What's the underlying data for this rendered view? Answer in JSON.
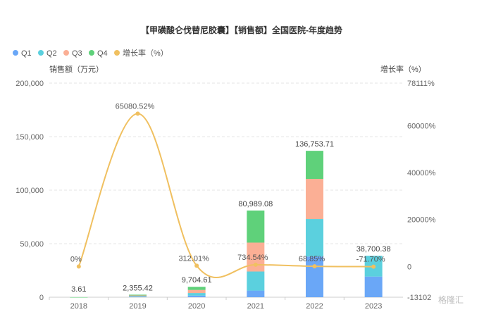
{
  "chart_data": {
    "type": "bar",
    "title": "【甲磺酸仑伐替尼胶囊】【销售额】全国医院-年度趋势",
    "categories": [
      "2018",
      "2019",
      "2020",
      "2021",
      "2022",
      "2023"
    ],
    "stacked": true,
    "series": [
      {
        "name": "Q1",
        "color": "#6aa7f7",
        "values": [
          1,
          400,
          1500,
          6200,
          38000,
          19300
        ]
      },
      {
        "name": "Q2",
        "color": "#5bd0de",
        "values": [
          1,
          600,
          2400,
          17800,
          35000,
          19400
        ]
      },
      {
        "name": "Q3",
        "color": "#fbaf95",
        "values": [
          1,
          650,
          2900,
          27000,
          37500,
          0
        ]
      },
      {
        "name": "Q4",
        "color": "#5fd17a",
        "values": [
          0.61,
          705.42,
          2904.61,
          29989.08,
          26253.71,
          0
        ]
      }
    ],
    "totals": [
      3.61,
      2355.42,
      9704.61,
      80989.08,
      136753.71,
      38700.38
    ],
    "total_labels": [
      "3.61",
      "2,355.42",
      "9,704.61",
      "80,989.08",
      "136,753.71",
      "38,700.38"
    ],
    "growth": {
      "name": "增长率（%）",
      "color": "#f0c060",
      "values": [
        0,
        65080.52,
        312.01,
        734.54,
        68.85,
        -71.7
      ],
      "labels": [
        "0%",
        "65080.52%",
        "312.01%",
        "734.54%",
        "68.85%",
        "-71.70%"
      ]
    },
    "ylabel_left": "销售额（万元）",
    "ylabel_right": "增长率（%）",
    "ylim_left": [
      0,
      200000
    ],
    "yticks_left": [
      "0",
      "50,000",
      "100,000",
      "150,000",
      "200,000"
    ],
    "ylim_right": [
      -13102,
      78111
    ],
    "yticks_right_values": [
      0,
      20000,
      40000,
      60000
    ],
    "yticks_right": [
      "0",
      "20000%",
      "40000%",
      "60000%"
    ],
    "yticks_right_top": "78111%",
    "yticks_right_bottom": "-13102",
    "grid": true,
    "legend_position": "top-left"
  },
  "watermark": "格隆汇"
}
